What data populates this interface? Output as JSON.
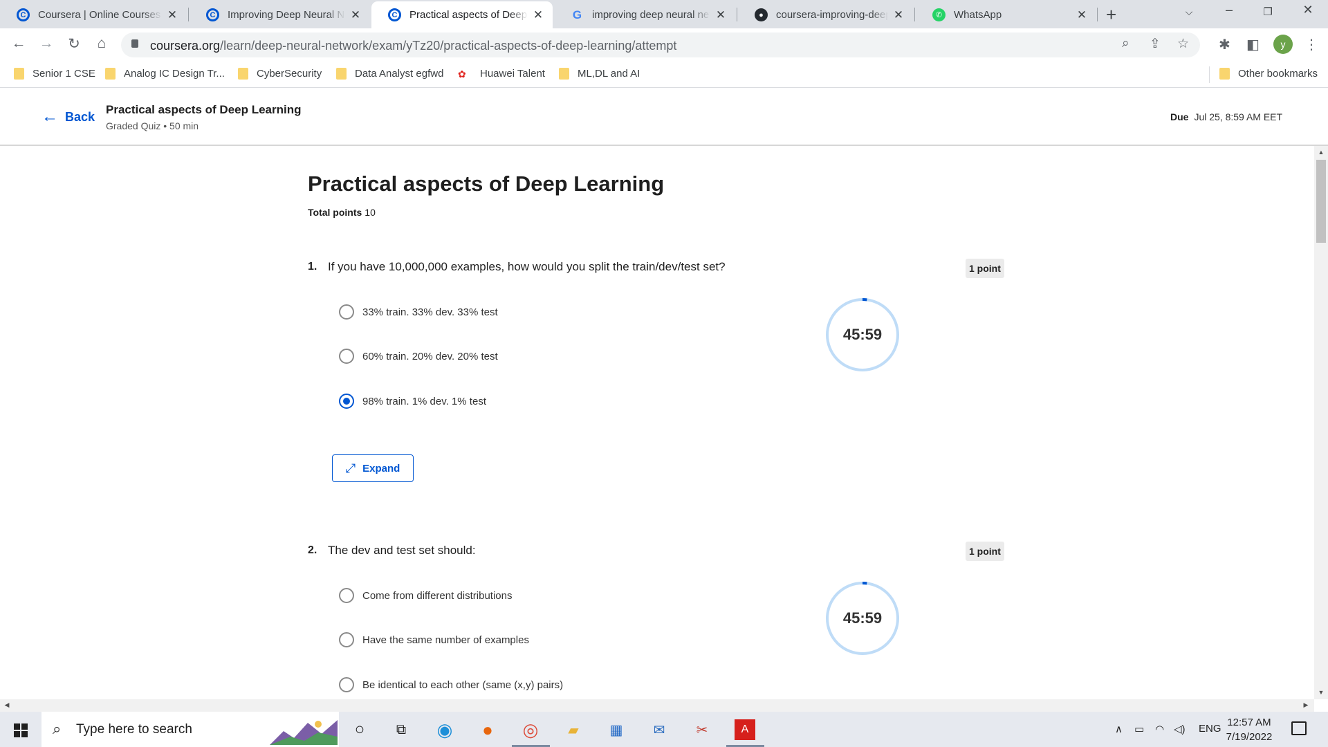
{
  "browser": {
    "tabs": [
      {
        "title": "Coursera | Online Courses & Credentials",
        "favicon": "coursera-icon",
        "active": false
      },
      {
        "title": "Improving Deep Neural Networks",
        "favicon": "coursera-icon",
        "active": false
      },
      {
        "title": "Practical aspects of Deep Learning",
        "favicon": "coursera-icon",
        "active": true
      },
      {
        "title": "improving deep neural networks",
        "favicon": "google-icon",
        "active": false
      },
      {
        "title": "coursera-improving-deep-neural",
        "favicon": "github-icon",
        "active": false
      },
      {
        "title": "WhatsApp",
        "favicon": "whatsapp-icon",
        "active": false
      }
    ],
    "url_host": "coursera.org",
    "url_path": "/learn/deep-neural-network/exam/yTz20/practical-aspects-of-deep-learning/attempt",
    "profile_initial": "y",
    "bookmarks": [
      "Senior 1 CSE",
      "Analog IC Design Tr...",
      "CyberSecurity",
      "Data Analyst egfwd",
      "Huawei Talent",
      "ML,DL and AI"
    ],
    "other_bookmarks": "Other bookmarks"
  },
  "header": {
    "back_label": "Back",
    "title": "Practical aspects of Deep Learning",
    "subtitle": "Graded Quiz • 50 min",
    "due_label": "Due",
    "due_value": "Jul 25, 8:59 AM EET"
  },
  "quiz": {
    "title": "Practical aspects of Deep Learning",
    "total_points_label": "Total points",
    "total_points_value": "10",
    "expand_label": "Expand",
    "timer": "45:59",
    "timer_progress": 0.02,
    "accent_color": "#0056d2",
    "questions": [
      {
        "number": "1.",
        "text": "If you have 10,000,000 examples, how would you split the train/dev/test set?",
        "points": "1 point",
        "options": [
          "33% train. 33% dev. 33% test",
          "60% train. 20% dev. 20% test",
          "98% train. 1% dev. 1% test"
        ],
        "selected_index": 2
      },
      {
        "number": "2.",
        "text": "The dev and test set should:",
        "points": "1 point",
        "options": [
          "Come from different distributions",
          "Have the same number of examples",
          "Be identical to each other (same (x,y) pairs)"
        ],
        "selected_index": null
      }
    ]
  },
  "taskbar": {
    "search_placeholder": "Type here to search",
    "language": "ENG",
    "time": "12:57 AM",
    "date": "7/19/2022"
  }
}
